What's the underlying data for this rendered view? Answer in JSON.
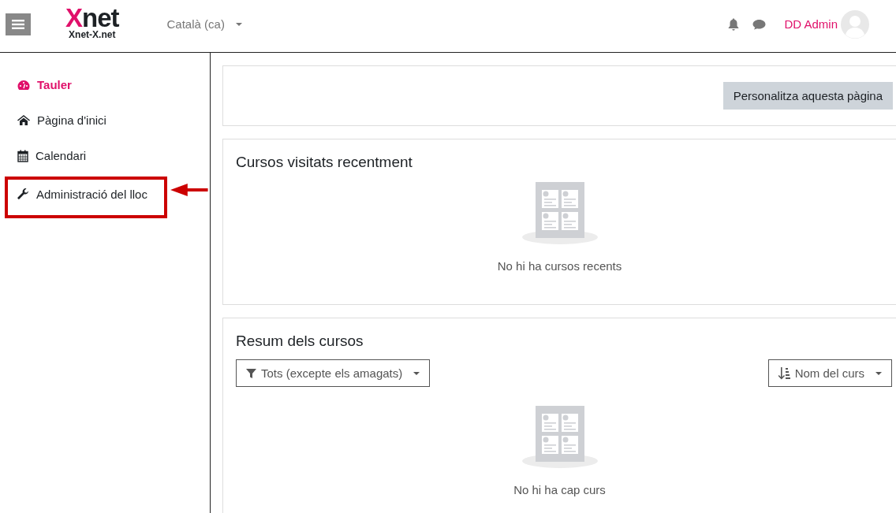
{
  "header": {
    "logo": {
      "text": "Xnet",
      "subtitle": "Xnet-X.net"
    },
    "language": "Català (ca)",
    "user": "DD Admin"
  },
  "sidebar": {
    "items": [
      {
        "label": "Tauler",
        "selected": true,
        "highlighted": false
      },
      {
        "label": "Pàgina d'inici",
        "selected": false,
        "highlighted": false
      },
      {
        "label": "Calendari",
        "selected": false,
        "highlighted": false
      },
      {
        "label": "Administració del lloc",
        "selected": false,
        "highlighted": true
      }
    ]
  },
  "customize_button": "Personalitza aquesta pàgina",
  "recent": {
    "title": "Cursos visitats recentment",
    "empty": "No hi ha cursos recents"
  },
  "overview": {
    "title": "Resum dels cursos",
    "filter": "Tots (excepte els amagats)",
    "sort": "Nom del curs",
    "empty": "No hi ha cap curs"
  }
}
